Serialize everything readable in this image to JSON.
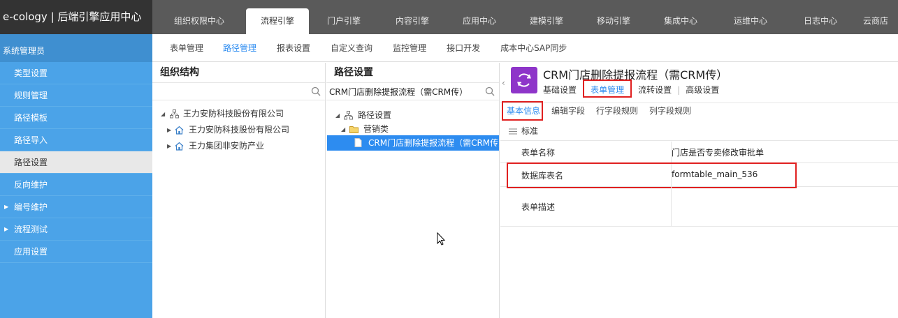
{
  "brand": "e-cology | 后端引擎应用中心",
  "main_tabs": [
    {
      "label": "组织权限中心"
    },
    {
      "label": "流程引擎"
    },
    {
      "label": "门户引擎"
    },
    {
      "label": "内容引擎"
    },
    {
      "label": "应用中心"
    },
    {
      "label": "建模引擎"
    },
    {
      "label": "移动引擎"
    },
    {
      "label": "集成中心"
    },
    {
      "label": "运维中心"
    },
    {
      "label": "日志中心"
    },
    {
      "label": "云商店"
    }
  ],
  "sub_nav": [
    {
      "label": "表单管理"
    },
    {
      "label": "路径管理"
    },
    {
      "label": "报表设置"
    },
    {
      "label": "自定义查询"
    },
    {
      "label": "监控管理"
    },
    {
      "label": "接口开发"
    },
    {
      "label": "成本中心SAP同步"
    }
  ],
  "sidebar": {
    "header": "系统管理员",
    "items": [
      {
        "label": "类型设置"
      },
      {
        "label": "规则管理"
      },
      {
        "label": "路径模板"
      },
      {
        "label": "路径导入"
      },
      {
        "label": "路径设置"
      },
      {
        "label": "反向维护"
      },
      {
        "label": "编号维护"
      },
      {
        "label": "流程测试"
      },
      {
        "label": "应用设置"
      }
    ]
  },
  "org_panel": {
    "title": "组织结构",
    "search_value": "",
    "tree": {
      "root": "王力安防科技股份有限公司",
      "children": [
        "王力安防科技股份有限公司",
        "王力集团非安防产业"
      ]
    }
  },
  "path_panel": {
    "title": "路径设置",
    "search_value": "CRM门店删除提报流程（需CRM传）",
    "tree": {
      "root": "路径设置",
      "folder": "营销类",
      "item": "CRM门店删除提报流程（需CRM传）"
    }
  },
  "detail": {
    "title": "CRM门店删除提报流程（需CRM传）",
    "tabs": [
      {
        "label": "基础设置"
      },
      {
        "label": "表单管理"
      },
      {
        "label": "流转设置"
      },
      {
        "label": "高级设置"
      }
    ],
    "form_tabs": [
      {
        "label": "基本信息"
      },
      {
        "label": "编辑字段"
      },
      {
        "label": "行字段规则"
      },
      {
        "label": "列字段规则"
      }
    ],
    "section": "标准",
    "fields": [
      {
        "label": "表单名称",
        "value": "门店是否专卖修改审批单"
      },
      {
        "label": "数据库表名",
        "value": "formtable_main_536"
      },
      {
        "label": "表单描述",
        "value": ""
      }
    ]
  },
  "colors": {
    "accent": "#2d8cf0",
    "sidebar": "#4ba3e8",
    "topbar": "#5a5a5a",
    "highlight": "#e02020",
    "workflow_icon": "#8e35c9"
  }
}
